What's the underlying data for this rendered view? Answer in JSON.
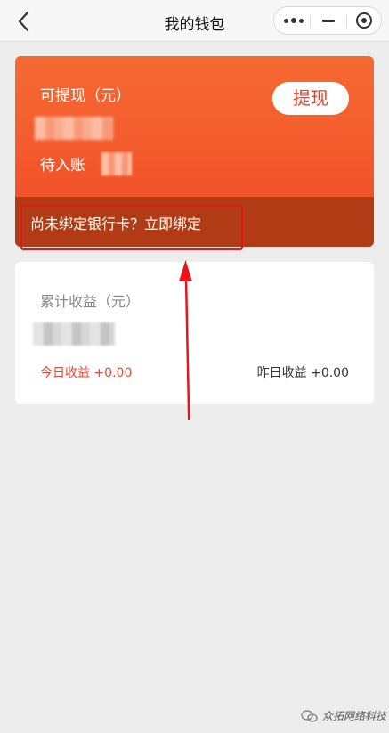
{
  "header": {
    "title": "我的钱包",
    "icons": {
      "back": "back-chevron-icon",
      "more": "more-dots-icon",
      "minimize": "minimize-icon",
      "close": "target-close-icon"
    }
  },
  "wallet": {
    "withdrawable_label": "可提现（元）",
    "pending_label": "待入账",
    "withdraw_button": "提现",
    "bind_text": "尚未绑定银行卡？立即绑定"
  },
  "earnings": {
    "total_label": "累计收益（元）",
    "today": "今日收益 +0.00",
    "yesterday": "昨日收益 +0.00"
  },
  "watermark": {
    "text": "众拓网络科技",
    "icon": "wechat-icon"
  },
  "colors": {
    "accent": "#f04a26",
    "highlight": "#e8141b",
    "bind_bar": "#b13b15"
  }
}
